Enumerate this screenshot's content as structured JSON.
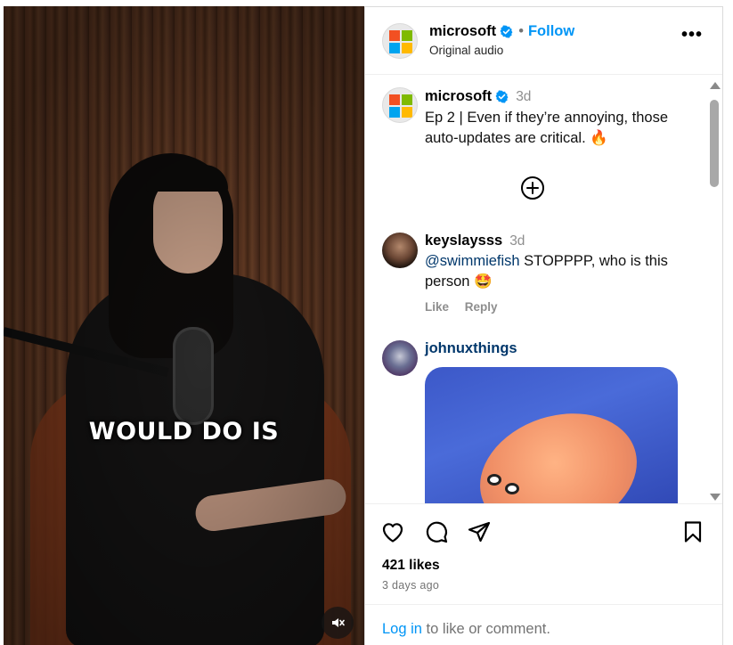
{
  "video": {
    "caption": "WOULD DO IS",
    "mute_icon": "speaker-muted-icon"
  },
  "header": {
    "username": "microsoft",
    "separator": "•",
    "follow_label": "Follow",
    "subtitle": "Original audio",
    "more_icon": "more-horizontal-icon",
    "more_label": "•••"
  },
  "post": {
    "username": "microsoft",
    "time": "3d",
    "text": "Ep 2 | Even if they’re annoying, those auto-updates are critical.",
    "emoji": "🔥"
  },
  "comments": [
    {
      "username": "keyslaysss",
      "time": "3d",
      "mention": "@swimmiefish",
      "text": " STOPPPP, who is this person",
      "emoji": "🤩",
      "like_label": "Like",
      "reply_label": "Reply"
    },
    {
      "username": "johnuxthings"
    }
  ],
  "actions": {
    "likes": "421 likes",
    "date": "3 days ago",
    "login_link": "Log in",
    "login_suffix": " to like or comment."
  },
  "colors": {
    "accent": "#0095f6",
    "link_dark": "#00376b",
    "muted": "#737373",
    "ms_red": "#f25022",
    "ms_green": "#7fba00",
    "ms_blue": "#00a4ef",
    "ms_yellow": "#ffb900"
  }
}
